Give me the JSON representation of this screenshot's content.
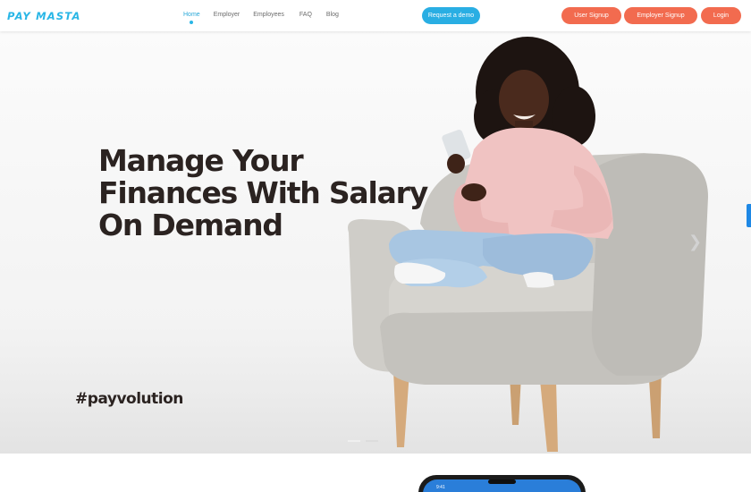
{
  "brand": {
    "name": "PAY MASTA",
    "color": "#29b6e6"
  },
  "nav": {
    "items": [
      {
        "label": "Home",
        "active": true
      },
      {
        "label": "Employer",
        "active": false
      },
      {
        "label": "Employees",
        "active": false
      },
      {
        "label": "FAQ",
        "active": false
      },
      {
        "label": "Blog",
        "active": false
      }
    ]
  },
  "header_buttons": {
    "demo": "Request a demo",
    "user_signup": "User Signup",
    "employer_signup": "Employer Signup",
    "login": "Login"
  },
  "hero": {
    "headline_lines": [
      "Manage Your",
      "Finances With Salary",
      "On Demand"
    ],
    "tagline": "#payvolution",
    "slide_count": 2,
    "active_slide": 1
  },
  "colors": {
    "accent": "#29aee3",
    "cta": "#f26b4f",
    "headline": "#2b2321"
  },
  "phone": {
    "time": "9:41"
  }
}
